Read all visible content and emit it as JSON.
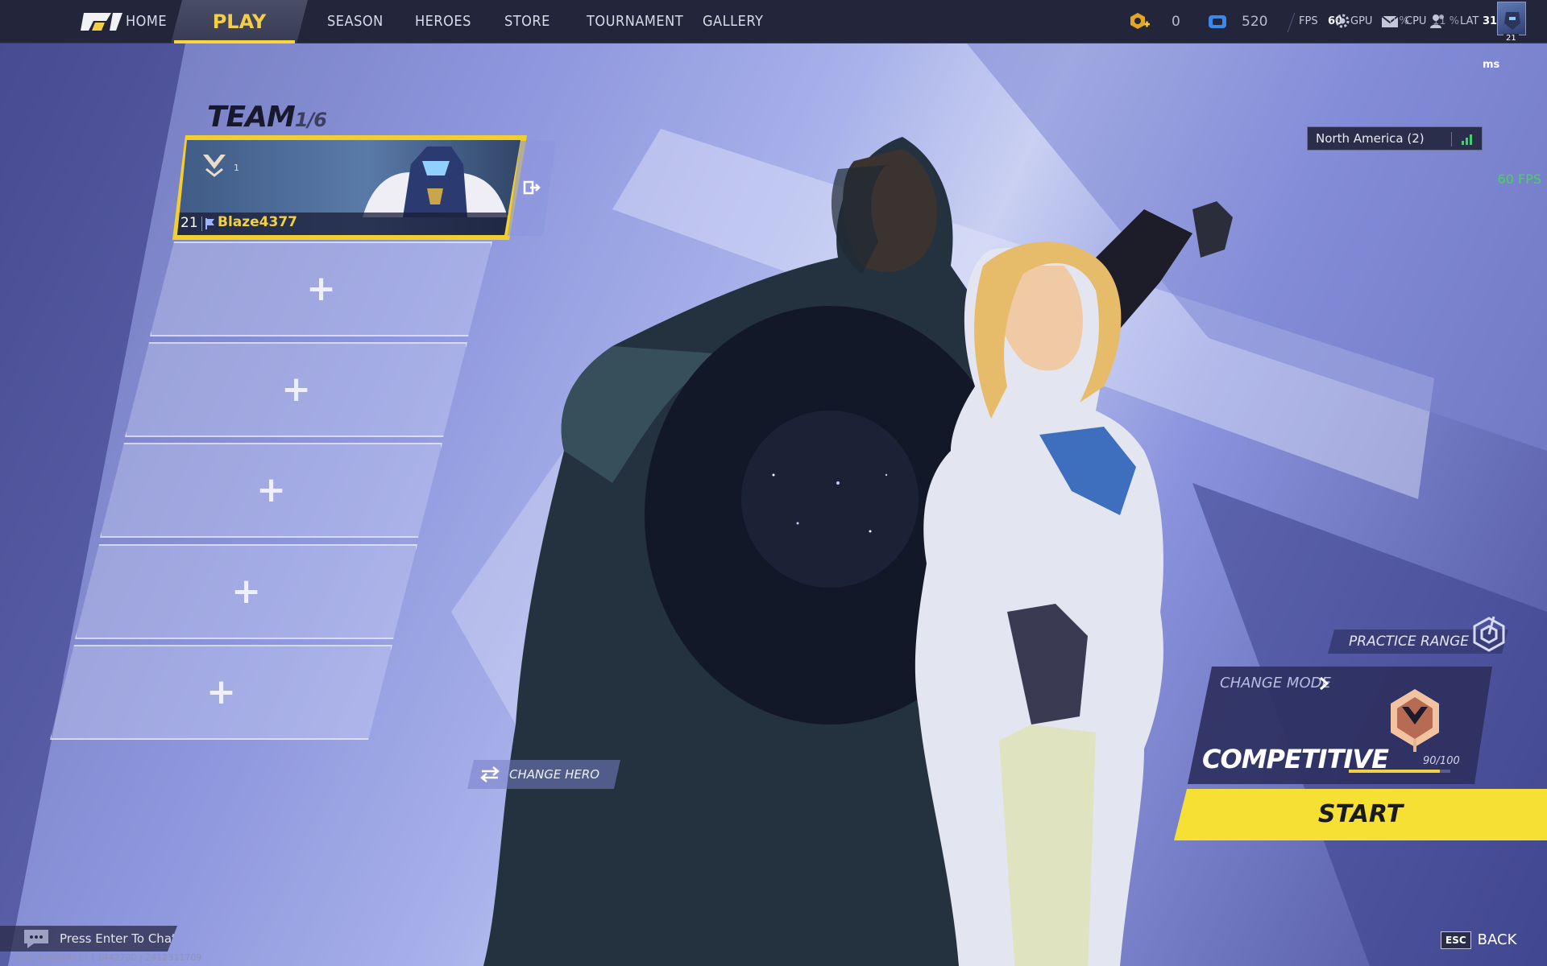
{
  "topbar": {
    "home_label": "HOME",
    "tabs": [
      {
        "label": "PLAY",
        "active": true
      },
      {
        "label": "SEASON"
      },
      {
        "label": "HEROES"
      },
      {
        "label": "STORE"
      },
      {
        "label": "TOURNAMENT"
      },
      {
        "label": "GALLERY"
      }
    ],
    "currency_1": {
      "icon": "gold-coin-plus-icon",
      "value": "0"
    },
    "currency_2": {
      "icon": "blue-ticket-icon",
      "value": "520"
    },
    "perf": {
      "fps_label": "FPS",
      "fps_value": "60",
      "gpu_label": "GPU",
      "gpu_value": "0 %",
      "cpu_label": "CPU",
      "cpu_value": "11 %",
      "lat_label": "LAT",
      "lat_value": "31 ms"
    },
    "profile_level": "21",
    "accent": "#f3cf45"
  },
  "team": {
    "title": "TEAM",
    "count": "1/6",
    "members": [
      {
        "level": "21",
        "name": "Blaze4377",
        "rank_digit": "1"
      }
    ],
    "empty_slots": [
      "+",
      "+",
      "+",
      "+",
      "+"
    ]
  },
  "region": {
    "label": "North America (2)"
  },
  "fps_overlay": "60 FPS",
  "practice_range": "PRACTICE RANGE",
  "mode": {
    "change_label": "CHANGE MODE",
    "name": "COMPETITIVE",
    "progress_text": "90/100",
    "progress": 0.9
  },
  "start_label": "START",
  "change_hero": "CHANGE HERO",
  "chat": {
    "placeholder": "Press Enter To Chat"
  },
  "uid": "UID: 530824517 | 1442700 | 2412311709",
  "back": {
    "key": "ESC",
    "label": "BACK"
  }
}
